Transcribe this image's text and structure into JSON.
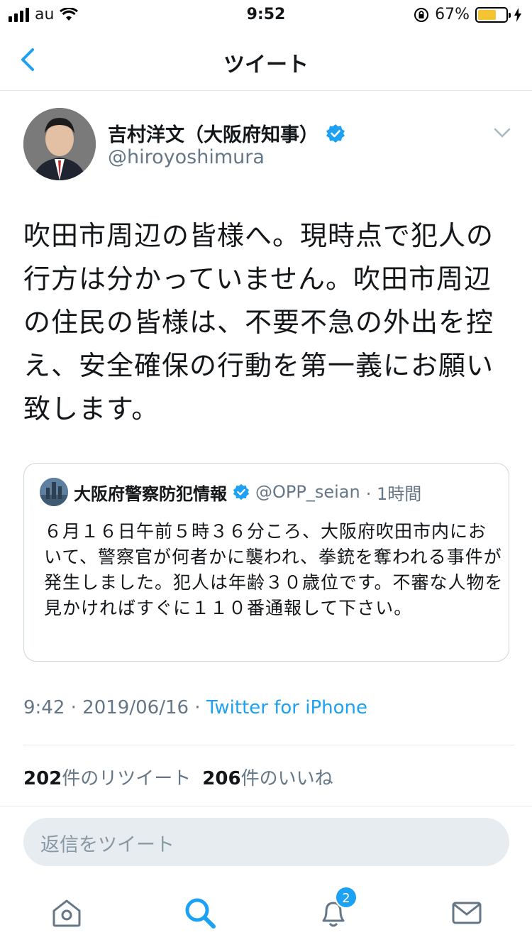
{
  "status_bar": {
    "carrier": "au",
    "time": "9:52",
    "battery_percent": "67%",
    "battery_level": 0.67,
    "battery_color": "#f5c432"
  },
  "nav": {
    "title": "ツイート",
    "back_icon": "chevron-left-icon"
  },
  "tweet": {
    "author_name": "吉村洋文（大阪府知事）",
    "author_handle": "@hiroyoshimura",
    "verified": true,
    "text": "吹田市周辺の皆様へ。現時点で犯人の行方は分かっていません。吹田市周辺の住民の皆様は、不要不急の外出を控え、安全確保の行動を第一義にお願い致します。",
    "time": "9:42 · 2019/06/16 · ",
    "via": "Twitter for iPhone",
    "retweet_count": "202",
    "retweet_label": "件のリツイート",
    "like_count": "206",
    "like_label": "件のいいね"
  },
  "quote": {
    "name": "大阪府警察防犯情報",
    "handle": "@OPP_seian",
    "age": "· 1時間",
    "text": "６月１６日午前５時３６分ころ、大阪府吹田市内において、警察官が何者かに襲われ、拳銃を奪われる事件が発生しました。犯人は年齢３０歳位です。不審な人物を見かければすぐに１１０番通報して下さい。"
  },
  "reply": {
    "placeholder": "返信をツイート"
  },
  "tabbar": {
    "notifications_badge": "2"
  },
  "colors": {
    "accent": "#1da1f2",
    "secondary_text": "#657786",
    "divider": "#e1e8ed"
  }
}
